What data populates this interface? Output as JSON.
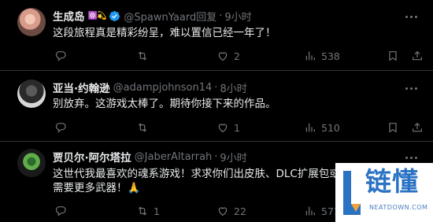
{
  "replies": [
    {
      "name": "生成岛",
      "name_badges": "⚛️💫",
      "verified": true,
      "handle": "@SpawnYaard回复",
      "dot": "·",
      "time": "9小时",
      "text": "这段旅程真是精彩纷呈，难以置信已经一年了！",
      "counts": {
        "reply": "",
        "retweet": "",
        "like": "2",
        "views": "538"
      }
    },
    {
      "name": "亚当·约翰逊",
      "handle": "@adampjohnson14",
      "dot": "·",
      "time": "8小时",
      "text": "别放弃。这游戏太棒了。期待你接下来的作品。",
      "counts": {
        "reply": "",
        "retweet": "",
        "like": "1",
        "views": "510"
      }
    },
    {
      "name": "贾贝尔·阿尔塔拉",
      "handle": "@JaberAltarrah",
      "dot": "·",
      "time": "9小时",
      "text": "这世代我最喜欢的魂系游戏！求求你们出皮肤、DLC扩展包或需要更多武器！🙏",
      "counts": {
        "reply": "",
        "retweet": "1",
        "like": "22",
        "views": "571"
      }
    }
  ],
  "watermark": {
    "title": "链懂",
    "subtitle": "NEATDOWN.COM"
  },
  "colors": {
    "background": "#000000",
    "text": "#e7e9ea",
    "muted": "#71767b",
    "verified_blue": "#1d9bf0",
    "divider": "#2f3336",
    "watermark_blue": "#2a72c3"
  }
}
